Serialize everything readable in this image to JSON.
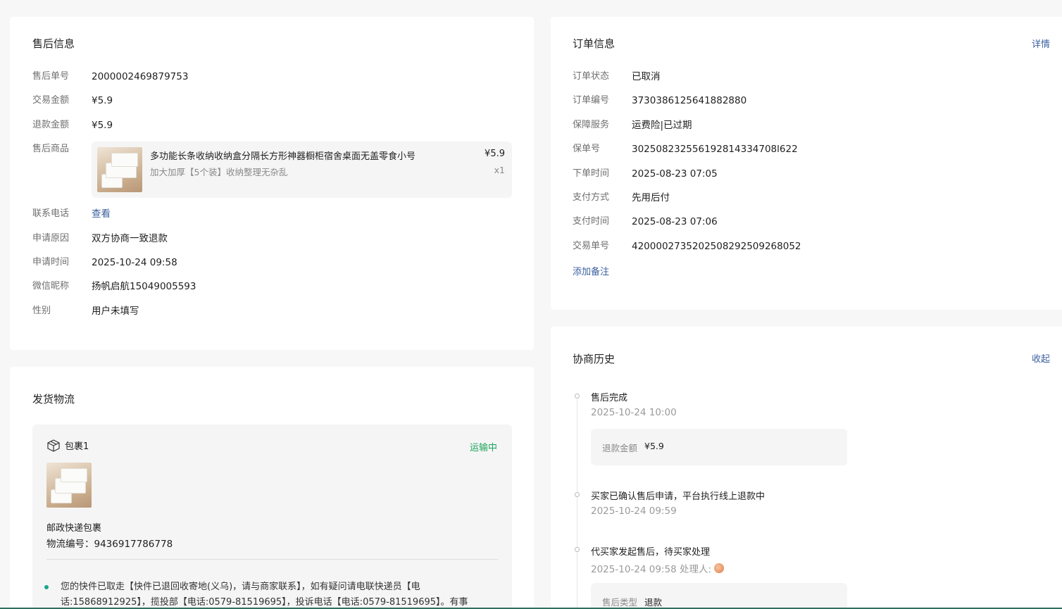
{
  "after_sales": {
    "title": "售后信息",
    "rows": [
      {
        "label": "售后单号",
        "value": "2000002469879753"
      },
      {
        "label": "交易金额",
        "value": "¥5.9"
      },
      {
        "label": "退款金额",
        "value": "¥5.9"
      },
      {
        "label": "售后商品",
        "value": ""
      },
      {
        "label": "联系电话",
        "value": "查看"
      },
      {
        "label": "申请原因",
        "value": "双方协商一致退款"
      },
      {
        "label": "申请时间",
        "value": "2025-10-24 09:58"
      },
      {
        "label": "微信昵称",
        "value": "扬帆启航15049005593"
      },
      {
        "label": "性别",
        "value": "用户未填写"
      }
    ],
    "product": {
      "name": "多功能长条收纳收纳盒分隔长方形神器橱柜宿舍桌面无盖零食小号",
      "spec": "加大加厚【5个装】收纳整理无杂乱",
      "price": "¥5.9",
      "qty": "x1"
    }
  },
  "logistics": {
    "title": "发货物流",
    "package": {
      "label": "包裹1",
      "status": "运输中",
      "courier": "邮政快递包裹",
      "tracking": "物流编号：9436917786778",
      "event": "您的快件已取走【快件已退回收寄地(义乌)，请与商家联系】，如有疑问请电联快递员【电话:15868912925】，揽投部【电话:0579-81519695】，投诉电话【电话:0579-81519695】。有事"
    }
  },
  "order": {
    "title": "订单信息",
    "detail_link": "详情",
    "rows": [
      {
        "label": "订单状态",
        "value": "已取消"
      },
      {
        "label": "订单编号",
        "value": "3730386125641882880"
      },
      {
        "label": "保障服务",
        "value": "运费险|已过期"
      },
      {
        "label": "保单号",
        "value": "302508232556192814334708l622"
      },
      {
        "label": "下单时间",
        "value": "2025-08-23 07:05"
      },
      {
        "label": "支付方式",
        "value": "先用后付"
      },
      {
        "label": "支付时间",
        "value": "2025-08-23 07:06"
      },
      {
        "label": "交易单号",
        "value": "4200002735202508292509268052"
      }
    ],
    "add_note": "添加备注"
  },
  "history": {
    "title": "协商历史",
    "collapse_link": "收起",
    "events": [
      {
        "title": "售后完成",
        "time": "2025-10-24 10:00",
        "box_label": "退款金额",
        "box_value": "¥5.9"
      },
      {
        "title": "买家已确认售后申请，平台执行线上退款中",
        "time": "2025-10-24 09:59"
      },
      {
        "title": "代买家发起售后，待买家处理",
        "time": "2025-10-24 09:58 处理人:",
        "box_label": "售后类型",
        "box_value": "退款"
      }
    ]
  },
  "colors": {
    "link": "#3a5f9f",
    "status_green": "#19a55a",
    "bg": "#f7f7f7"
  },
  "icons": {
    "package": "package-box-icon"
  }
}
